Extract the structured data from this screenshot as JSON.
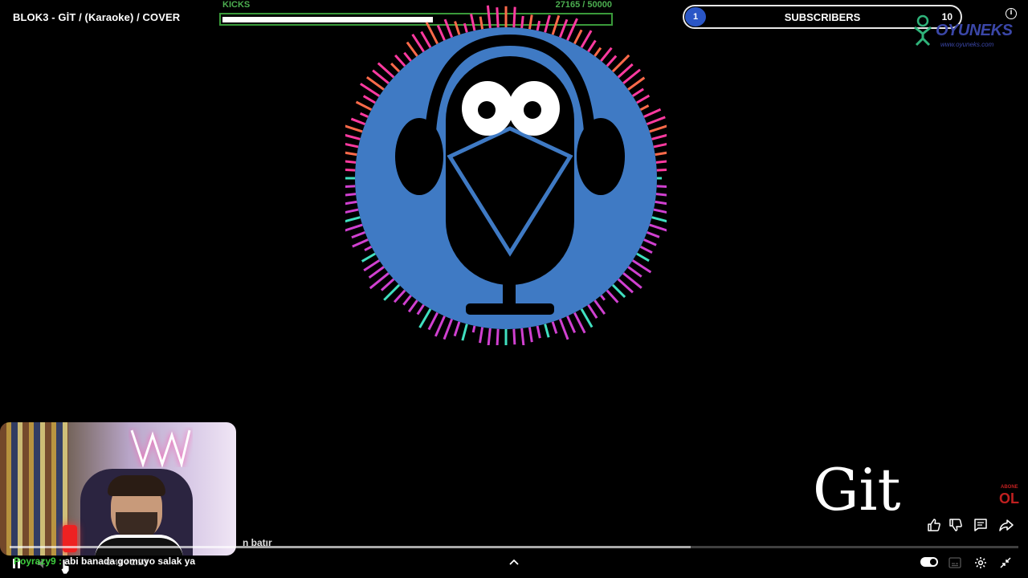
{
  "video": {
    "title": "BLOK3 - GİT / (Karaoke)  / COVER"
  },
  "kicks": {
    "label": "KICKS",
    "count_text": "27165  / 50000",
    "current": 27165,
    "goal": 50000
  },
  "subscribers": {
    "badge": "1",
    "label": "SUBSCRIBERS",
    "goal": "10"
  },
  "logo": {
    "name": "OYUNEKS",
    "url_text": "www.oyuneks.com"
  },
  "lyric": {
    "text": "Git"
  },
  "subscribe_badge": {
    "top": "ABONE",
    "main": "OL"
  },
  "chat": {
    "previous_fragment": "n batır",
    "user": "Poyrazy9 : ",
    "message": "abi banada gomuyo salak ya"
  },
  "player": {
    "progress_fraction": 0.675,
    "time_text": "0:41 / 2:23"
  },
  "colors": {
    "kicks_green": "#4caf50",
    "badge_blue": "#2a56c6",
    "logo_blue": "#3b47a8",
    "chat_user_green": "#3ecf3e",
    "viz_blue": "#3f7ac4",
    "viz_magenta": "#e040c0"
  },
  "icons": {
    "like": "thumbs-up-icon",
    "dislike": "thumbs-down-icon",
    "comments": "comment-icon",
    "share": "share-icon",
    "settings": "gear-icon",
    "captions": "captions-icon",
    "fullscreen_exit": "exit-fullscreen-icon",
    "chevron": "chevron-up-icon",
    "info": "info-icon"
  }
}
